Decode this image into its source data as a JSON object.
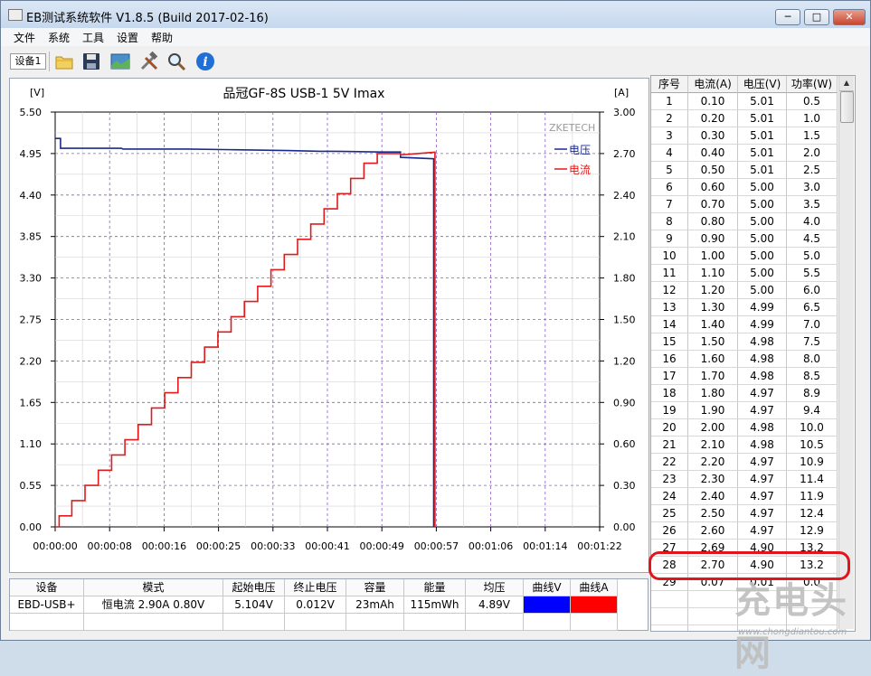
{
  "window": {
    "title": "EB测试系统软件 V1.8.5 (Build 2017-02-16)",
    "controls": {
      "minimize": "─",
      "maximize": "□",
      "close": "✕"
    }
  },
  "menu": [
    "文件",
    "系统",
    "工具",
    "设置",
    "帮助"
  ],
  "toolbar": {
    "device_label": "设备1",
    "icons": [
      "folder-icon",
      "save-icon",
      "chart-image-icon",
      "tools-icon",
      "magnifier-icon",
      "info-icon"
    ]
  },
  "colors": {
    "voltage": "#1a2a8c",
    "current": "#e01b1b",
    "grid": "#8a5fc0",
    "highlight": "#e0161c"
  },
  "chart_data": {
    "type": "line",
    "title": "品冠GF-8S USB-1  5V Imax",
    "ylabel_left": "[V]",
    "ylabel_right": "[A]",
    "watermark": "ZKETECH",
    "ylim_left": [
      0,
      5.5
    ],
    "ylim_right": [
      0,
      3.0
    ],
    "yticks_left": [
      "5.50",
      "4.95",
      "4.40",
      "3.85",
      "3.30",
      "2.75",
      "2.20",
      "1.65",
      "1.10",
      "0.55",
      "0.00"
    ],
    "yticks_right": [
      "3.00",
      "2.70",
      "2.40",
      "2.10",
      "1.80",
      "1.50",
      "1.20",
      "0.90",
      "0.60",
      "0.30",
      "0.00"
    ],
    "xticks": [
      "00:00:00",
      "00:00:08",
      "00:00:16",
      "00:00:25",
      "00:00:33",
      "00:00:41",
      "00:00:49",
      "00:00:57",
      "00:01:06",
      "00:01:14",
      "00:01:22"
    ],
    "x_range_seconds": [
      0,
      82
    ],
    "series": [
      {
        "name": "电压",
        "axis": "left",
        "color": "#1a2a8c",
        "points": [
          [
            0,
            5.15
          ],
          [
            0.8,
            5.15
          ],
          [
            0.8,
            5.02
          ],
          [
            10,
            5.02
          ],
          [
            10.2,
            5.01
          ],
          [
            20,
            5.01
          ],
          [
            27,
            5.0
          ],
          [
            35,
            4.99
          ],
          [
            40,
            4.98
          ],
          [
            42,
            4.98
          ],
          [
            49,
            4.97
          ],
          [
            52,
            4.97
          ],
          [
            52,
            4.9
          ],
          [
            57,
            4.88
          ],
          [
            57,
            0.0
          ]
        ]
      },
      {
        "name": "电流",
        "axis": "right",
        "color": "#e01b1b",
        "points": [
          [
            0,
            0
          ],
          [
            0.6,
            0
          ],
          [
            0.6,
            0.08
          ],
          [
            2.5,
            0.08
          ],
          [
            2.5,
            0.19
          ],
          [
            4.5,
            0.19
          ],
          [
            4.5,
            0.3
          ],
          [
            6.5,
            0.3
          ],
          [
            6.5,
            0.41
          ],
          [
            8.5,
            0.41
          ],
          [
            8.5,
            0.52
          ],
          [
            10.5,
            0.52
          ],
          [
            10.5,
            0.63
          ],
          [
            12.5,
            0.63
          ],
          [
            12.5,
            0.74
          ],
          [
            14.5,
            0.74
          ],
          [
            14.5,
            0.86
          ],
          [
            16.5,
            0.86
          ],
          [
            16.5,
            0.97
          ],
          [
            18.5,
            0.97
          ],
          [
            18.5,
            1.08
          ],
          [
            20.5,
            1.08
          ],
          [
            20.5,
            1.19
          ],
          [
            22.5,
            1.19
          ],
          [
            22.5,
            1.3
          ],
          [
            24.5,
            1.3
          ],
          [
            24.5,
            1.41
          ],
          [
            26.5,
            1.41
          ],
          [
            26.5,
            1.52
          ],
          [
            28.5,
            1.52
          ],
          [
            28.5,
            1.63
          ],
          [
            30.5,
            1.63
          ],
          [
            30.5,
            1.74
          ],
          [
            32.5,
            1.74
          ],
          [
            32.5,
            1.86
          ],
          [
            34.5,
            1.86
          ],
          [
            34.5,
            1.97
          ],
          [
            36.5,
            1.97
          ],
          [
            36.5,
            2.08
          ],
          [
            38.5,
            2.08
          ],
          [
            38.5,
            2.19
          ],
          [
            40.5,
            2.19
          ],
          [
            40.5,
            2.3
          ],
          [
            42.5,
            2.3
          ],
          [
            42.5,
            2.41
          ],
          [
            44.5,
            2.41
          ],
          [
            44.5,
            2.52
          ],
          [
            46.5,
            2.52
          ],
          [
            46.5,
            2.63
          ],
          [
            48.5,
            2.63
          ],
          [
            48.5,
            2.7
          ],
          [
            52,
            2.7
          ],
          [
            52,
            2.69
          ],
          [
            57.2,
            2.71
          ],
          [
            57.2,
            0.0
          ]
        ]
      }
    ]
  },
  "list": {
    "headers": [
      "序号",
      "电流(A)",
      "电压(V)",
      "功率(W)"
    ],
    "rows": [
      [
        "1",
        "0.10",
        "5.01",
        "0.5"
      ],
      [
        "2",
        "0.20",
        "5.01",
        "1.0"
      ],
      [
        "3",
        "0.30",
        "5.01",
        "1.5"
      ],
      [
        "4",
        "0.40",
        "5.01",
        "2.0"
      ],
      [
        "5",
        "0.50",
        "5.01",
        "2.5"
      ],
      [
        "6",
        "0.60",
        "5.00",
        "3.0"
      ],
      [
        "7",
        "0.70",
        "5.00",
        "3.5"
      ],
      [
        "8",
        "0.80",
        "5.00",
        "4.0"
      ],
      [
        "9",
        "0.90",
        "5.00",
        "4.5"
      ],
      [
        "10",
        "1.00",
        "5.00",
        "5.0"
      ],
      [
        "11",
        "1.10",
        "5.00",
        "5.5"
      ],
      [
        "12",
        "1.20",
        "5.00",
        "6.0"
      ],
      [
        "13",
        "1.30",
        "4.99",
        "6.5"
      ],
      [
        "14",
        "1.40",
        "4.99",
        "7.0"
      ],
      [
        "15",
        "1.50",
        "4.98",
        "7.5"
      ],
      [
        "16",
        "1.60",
        "4.98",
        "8.0"
      ],
      [
        "17",
        "1.70",
        "4.98",
        "8.5"
      ],
      [
        "18",
        "1.80",
        "4.97",
        "8.9"
      ],
      [
        "19",
        "1.90",
        "4.97",
        "9.4"
      ],
      [
        "20",
        "2.00",
        "4.98",
        "10.0"
      ],
      [
        "21",
        "2.10",
        "4.98",
        "10.5"
      ],
      [
        "22",
        "2.20",
        "4.97",
        "10.9"
      ],
      [
        "23",
        "2.30",
        "4.97",
        "11.4"
      ],
      [
        "24",
        "2.40",
        "4.97",
        "11.9"
      ],
      [
        "25",
        "2.50",
        "4.97",
        "12.4"
      ],
      [
        "26",
        "2.60",
        "4.97",
        "12.9"
      ],
      [
        "27",
        "2.69",
        "4.90",
        "13.2"
      ],
      [
        "28",
        "2.70",
        "4.90",
        "13.2"
      ],
      [
        "29",
        "0.07",
        "0.01",
        "0.0"
      ]
    ],
    "highlighted_row": 28
  },
  "summary": {
    "headers": [
      "设备",
      "模式",
      "起始电压",
      "终止电压",
      "容量",
      "能量",
      "均压",
      "曲线V",
      "曲线A"
    ],
    "values": [
      "EBD-USB+",
      "恒电流  2.90A  0.80V",
      "5.104V",
      "0.012V",
      "23mAh",
      "115mWh",
      "4.89V",
      "",
      ""
    ],
    "swatches": {
      "curve_v": "#0000ff",
      "curve_a": "#ff0000"
    }
  },
  "watermark": {
    "text": "充电头网",
    "url": "www.chongdiantou.com"
  }
}
